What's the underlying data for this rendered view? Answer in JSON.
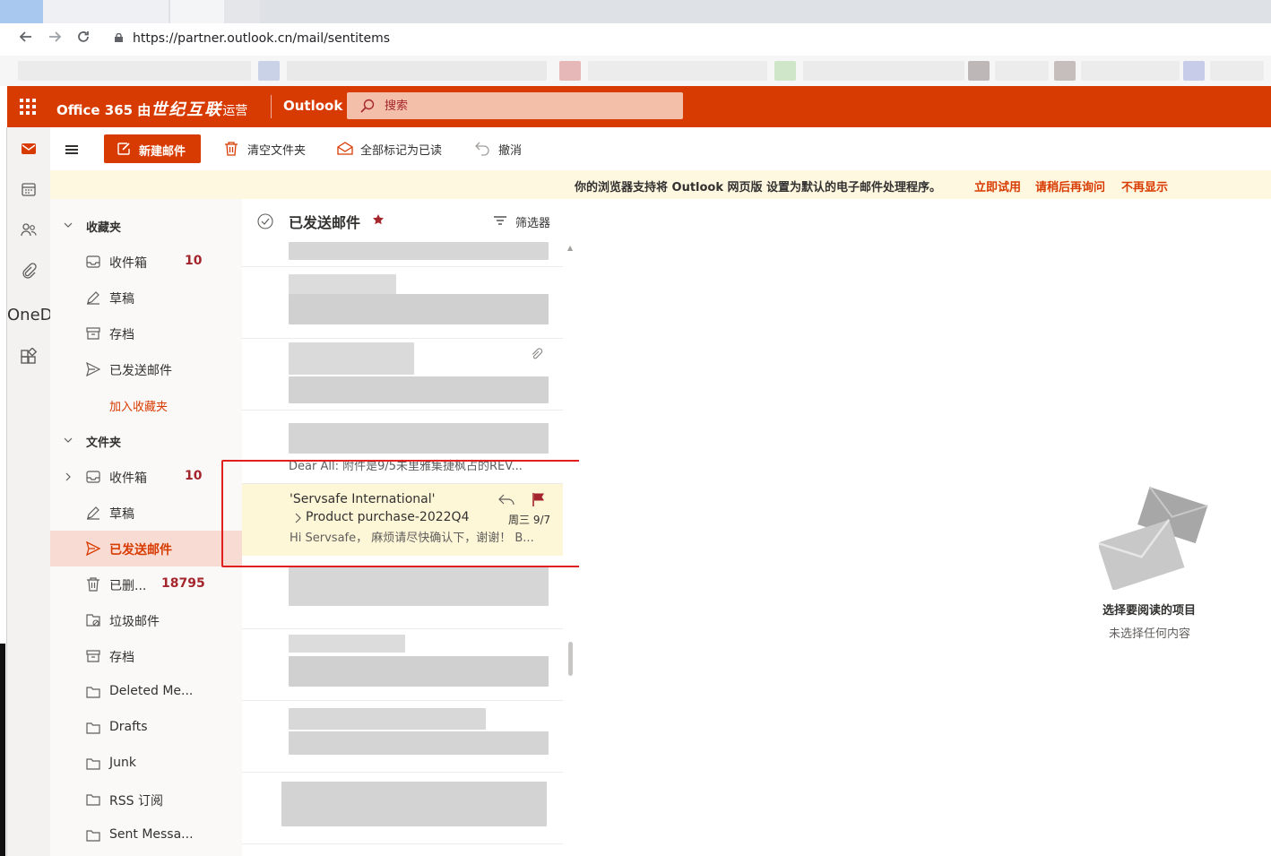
{
  "browser": {
    "url": "https://partner.outlook.cn/mail/sentitems"
  },
  "header": {
    "brand_part1": "Office 365 由",
    "brand_part2": "世纪互联",
    "brand_part3": "运营",
    "app_title": "Outlook",
    "search_placeholder": "搜索"
  },
  "rail": {
    "onedrive_fragment": "OneD"
  },
  "toolbar": {
    "new_mail": "新建邮件",
    "empty_folder": "清空文件夹",
    "mark_all_read": "全部标记为已读",
    "undo": "撤消"
  },
  "banner": {
    "message": "你的浏览器支持将 Outlook 网页版 设置为默认的电子邮件处理程序。",
    "try_now": "立即试用",
    "ask_later": "请稍后再询问",
    "dont_show": "不再显示"
  },
  "folders": {
    "favorites_label": "收藏夹",
    "favorites": [
      {
        "label": "收件箱",
        "count": "10"
      },
      {
        "label": "草稿",
        "count": ""
      },
      {
        "label": "存档",
        "count": ""
      },
      {
        "label": "已发送邮件",
        "count": ""
      }
    ],
    "add_favorite": "加入收藏夹",
    "folders_label": "文件夹",
    "items": [
      {
        "label": "收件箱",
        "count": "10"
      },
      {
        "label": "草稿",
        "count": ""
      },
      {
        "label": "已发送邮件",
        "count": ""
      },
      {
        "label": "已删...",
        "count": "18795"
      },
      {
        "label": "垃圾邮件",
        "count": ""
      },
      {
        "label": "存档",
        "count": ""
      },
      {
        "label": "Deleted Me...",
        "count": ""
      },
      {
        "label": "Drafts",
        "count": ""
      },
      {
        "label": "Junk",
        "count": ""
      },
      {
        "label": "RSS 订阅",
        "count": ""
      },
      {
        "label": "Sent Messa...",
        "count": ""
      }
    ]
  },
  "message_list": {
    "title": "已发送邮件",
    "filter_label": "筛选器",
    "partial_preview": "Dear All:  附件是9/5未里雅集捷枫占的REV...",
    "selected_message": {
      "sender": "'Servsafe International'",
      "subject": "Product purchase-2022Q4",
      "date": "周三 9/7",
      "preview": "Hi Servsafe， 麻烦请尽快确认下，谢谢！ B..."
    }
  },
  "reading_pane": {
    "empty_title": "选择要阅读的项目",
    "empty_subtitle": "未选择任何内容"
  },
  "colors": {
    "accent": "#d83b01",
    "selected_folder_bg": "#f8dcd4",
    "selected_message_bg": "#fdf6d7",
    "highlight_border": "#e02020"
  }
}
